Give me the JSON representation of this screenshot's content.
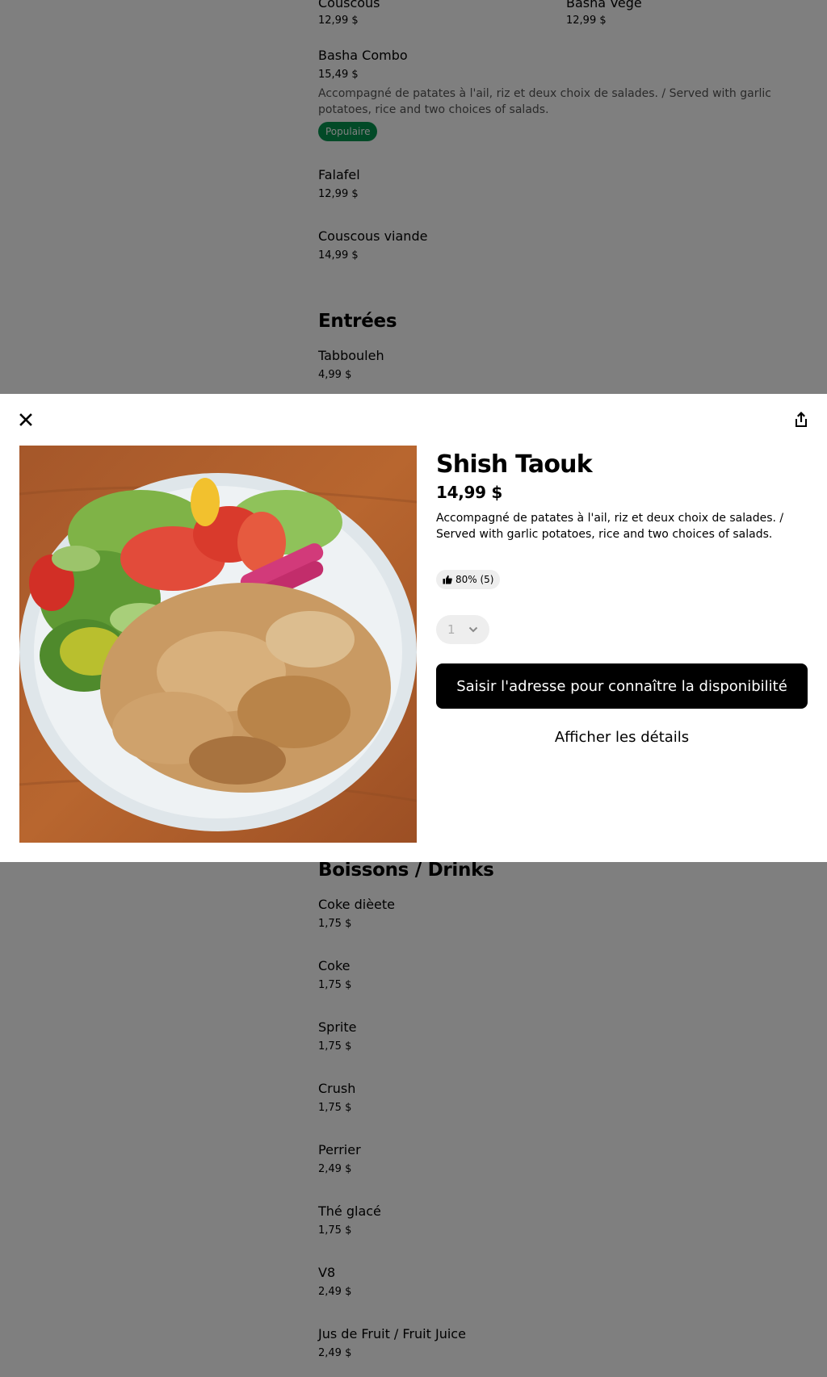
{
  "menu": {
    "top_items": [
      {
        "name": "Couscous",
        "price": "12,99 $"
      },
      {
        "name": "Basha Vege",
        "price": "12,99 $"
      },
      {
        "name": "Basha Combo",
        "price": "15,49 $",
        "description": "Accompagné de patates à l'ail, riz et deux choix de salades. / Served with garlic potatoes, rice and two choices of salads.",
        "badge": "Populaire"
      },
      {
        "name": "Falafel",
        "price": "12,99 $"
      },
      {
        "name": "Couscous viande",
        "price": "14,99 $"
      }
    ],
    "entrees": {
      "title": "Entrées",
      "items": [
        {
          "name": "Tabbouleh",
          "price": "4,99 $"
        }
      ]
    },
    "drinks": {
      "title": "Boissons / Drinks",
      "items": [
        {
          "name": "Coke dièete",
          "price": "1,75 $"
        },
        {
          "name": "Coke",
          "price": "1,75 $"
        },
        {
          "name": "Sprite",
          "price": "1,75 $"
        },
        {
          "name": "Crush",
          "price": "1,75 $"
        },
        {
          "name": "Perrier",
          "price": "2,49 $"
        },
        {
          "name": "Thé glacé",
          "price": "1,75 $"
        },
        {
          "name": "V8",
          "price": "2,49 $"
        },
        {
          "name": "Jus de Fruit / Fruit Juice",
          "price": "2,49 $"
        }
      ]
    }
  },
  "modal": {
    "title": "Shish Taouk",
    "price": "14,99 $",
    "description": "Accompagné de patates à l'ail, riz et deux choix de salades. / Served with garlic potatoes, rice and two choices of salads.",
    "rating": "80% (5)",
    "quantity": "1",
    "cta_label": "Saisir l'adresse pour connaître la disponibilité",
    "details_label": "Afficher les détails"
  },
  "colors": {
    "badge_green": "#05944f",
    "overlay": "rgba(0,0,0,0.5)",
    "cta_bg": "#000000"
  }
}
